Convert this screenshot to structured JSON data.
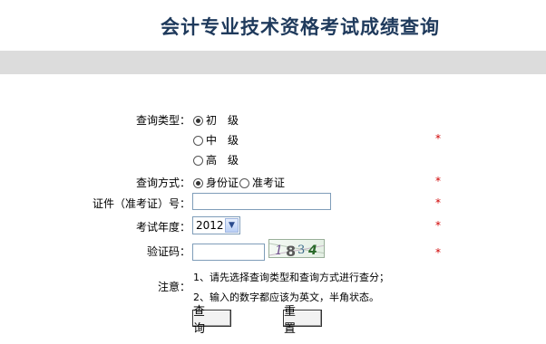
{
  "page": {
    "title": "会计专业技术资格考试成绩查询"
  },
  "form": {
    "query_type": {
      "label": "查询类型：",
      "options": [
        {
          "label": "初　级",
          "checked": true
        },
        {
          "label": "中　级",
          "checked": false
        },
        {
          "label": "高　级",
          "checked": false
        }
      ]
    },
    "query_method": {
      "label": "查询方式：",
      "options": [
        {
          "label": "身份证",
          "checked": true
        },
        {
          "label": "准考证",
          "checked": false
        }
      ]
    },
    "id_number": {
      "label": "证件（准考证）号：",
      "value": ""
    },
    "exam_year": {
      "label": "考试年度：",
      "selected": "2012"
    },
    "captcha": {
      "label": "验证码：",
      "value": "",
      "image_text": "1834"
    },
    "required_mark": "*",
    "notes": {
      "label": "注意：",
      "lines": [
        "1、请先选择查询类型和查询方式进行查分；",
        "2、输入的数字都应该为英文，半角状态。"
      ]
    },
    "buttons": {
      "query": "查 询",
      "reset": "重 置"
    }
  },
  "colors": {
    "title": "#1f3a5c",
    "band": "#dcdcdc",
    "required": "#d00000"
  }
}
